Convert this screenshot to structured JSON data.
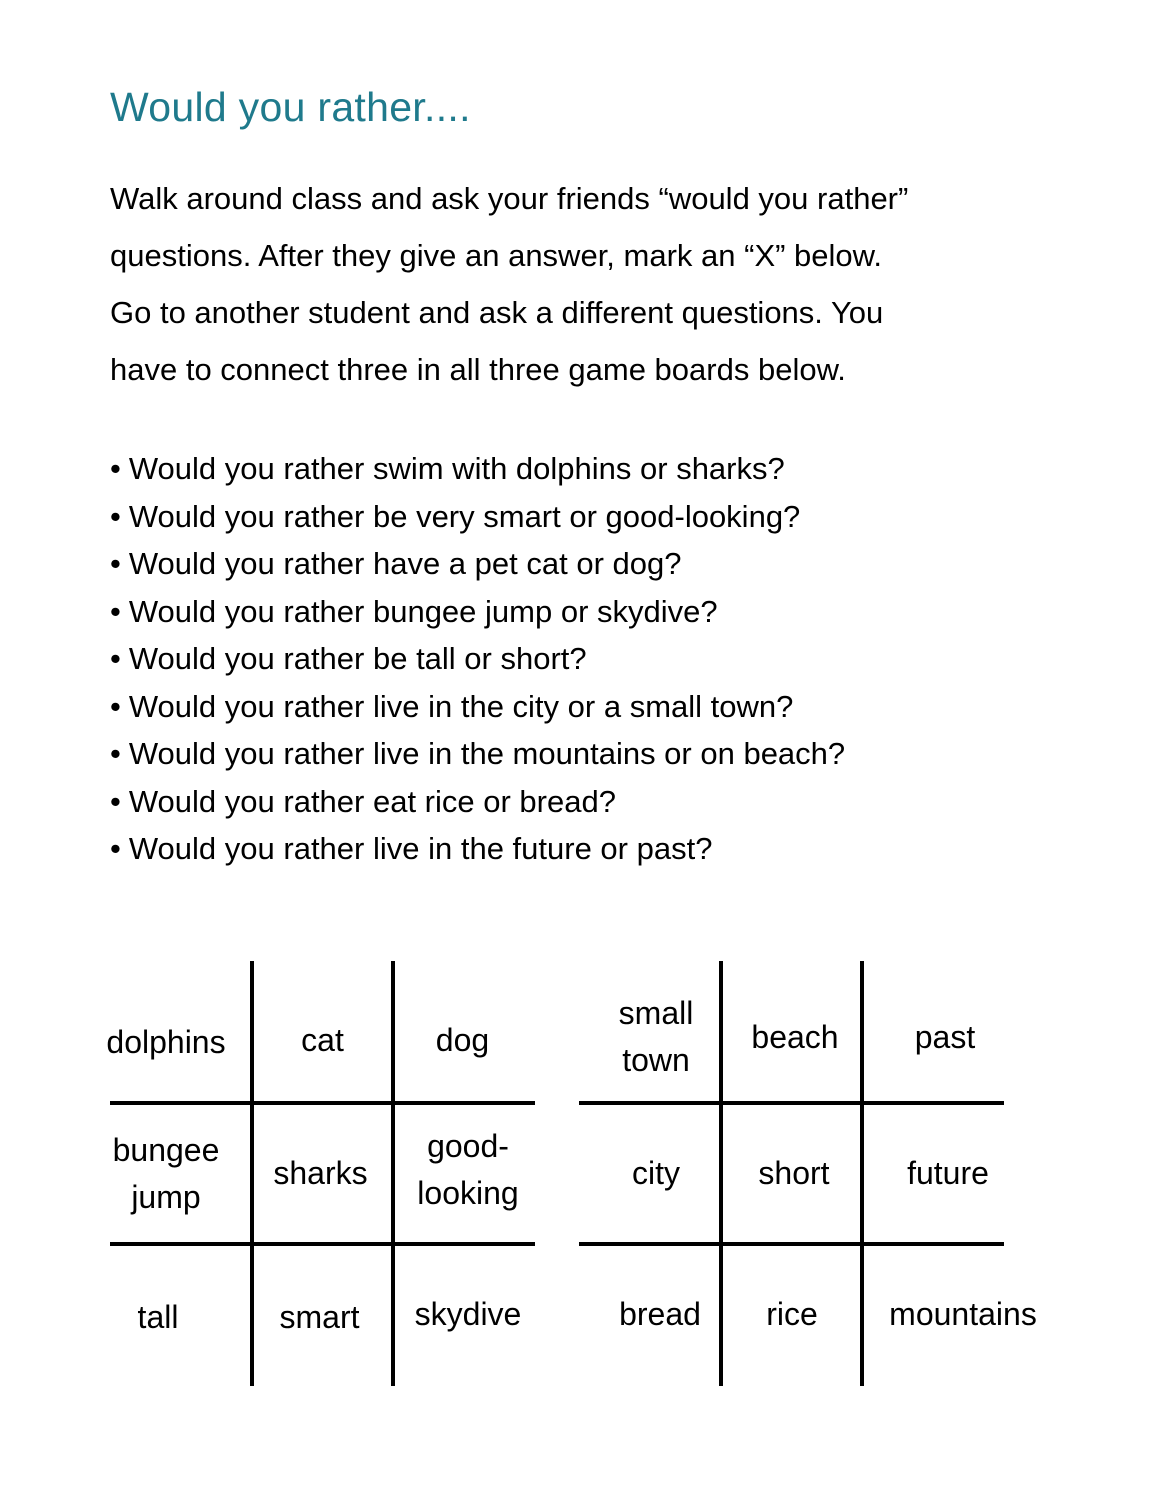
{
  "title": "Would you rather....",
  "intro_lines": [
    "Walk around class and ask your friends “would you rather”",
    "questions.  After they give an answer, mark an “X” below.",
    "Go to another student and ask a different questions. You",
    "have to connect three in all three game boards below."
  ],
  "bullet_glyph": "•",
  "questions": [
    "Would you rather swim with dolphins or sharks?",
    "Would you rather be very smart or good-looking?",
    "Would you rather have a pet cat or dog?",
    "Would you rather bungee jump or skydive?",
    "Would you rather be tall or short?",
    "Would you rather live in the city or a small town?",
    "Would you rather live in the mountains or on beach?",
    "Would you rather eat rice or bread?",
    "Would you rather live in the future or past?"
  ],
  "boards": [
    {
      "cells": [
        [
          "dolphins",
          "cat",
          "dog"
        ],
        [
          "bungee jump",
          "sharks",
          "good-looking"
        ],
        [
          "tall",
          "smart",
          "skydive"
        ]
      ],
      "cells_display": [
        [
          "dolphins",
          "cat",
          "dog"
        ],
        [
          "bungee\njump",
          "sharks",
          "good-\nlooking"
        ],
        [
          "tall",
          "smart",
          "skydive"
        ]
      ]
    },
    {
      "cells": [
        [
          "small town",
          "beach",
          "past"
        ],
        [
          "city",
          "short",
          "future"
        ],
        [
          "bread",
          "rice",
          "mountains"
        ]
      ],
      "cells_display": [
        [
          "small\ntown",
          "beach",
          "past"
        ],
        [
          "city",
          "short",
          "future"
        ],
        [
          "bread",
          "rice",
          "mountains"
        ]
      ]
    }
  ],
  "colors": {
    "title": "#1f7a8c",
    "text": "#000000",
    "grid": "#000000"
  }
}
